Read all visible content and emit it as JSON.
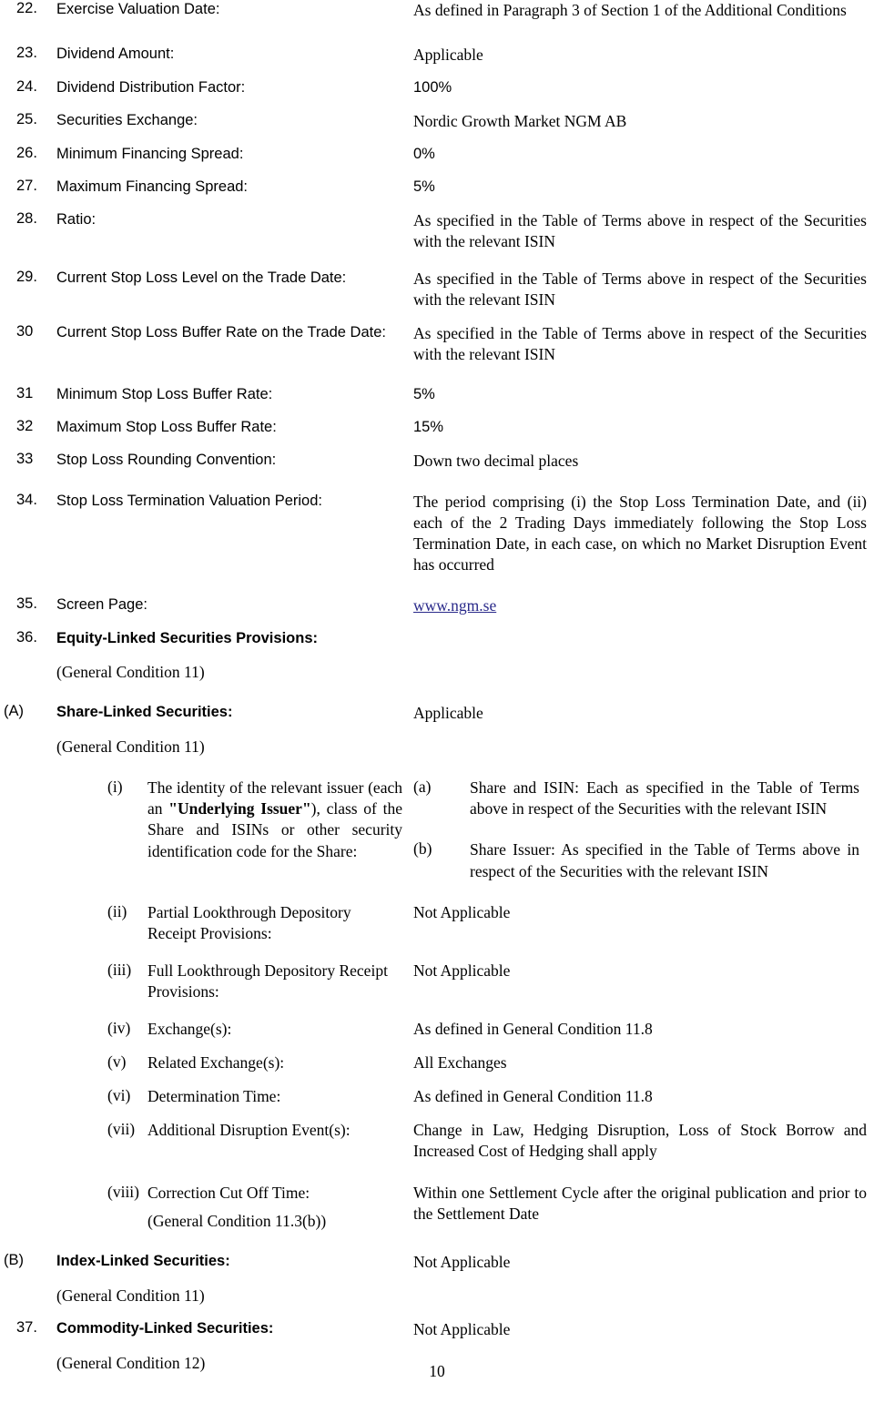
{
  "document": {
    "page_number": "10",
    "value_boilerplate": "As specified in the Table of Terms above in respect of the Securities with the relevant ISIN",
    "not_applicable": "Not Applicable",
    "applicable": "Applicable"
  },
  "items": [
    {
      "num": "22.",
      "label": "Exercise Valuation Date:",
      "value": "As defined in Paragraph 3 of Section 1 of the Additional Conditions"
    },
    {
      "num": "23.",
      "label": "Dividend Amount:",
      "value": "Applicable"
    },
    {
      "num": "24.",
      "label": "Dividend Distribution Factor:",
      "value": "100%"
    },
    {
      "num": "25.",
      "label": "Securities Exchange:",
      "value": "Nordic Growth Market NGM AB"
    },
    {
      "num": "26.",
      "label": "Minimum Financing Spread:",
      "value": "0%"
    },
    {
      "num": "27.",
      "label": "Maximum Financing Spread:",
      "value": "5%"
    },
    {
      "num": "28.",
      "label": "Ratio:",
      "value": "As specified in the Table of Terms above in respect of the Securities with the relevant ISIN"
    },
    {
      "num": "29.",
      "label": "Current Stop Loss Level on the Trade Date:",
      "value": "As specified in the Table of Terms above in respect of the Securities with the relevant ISIN"
    },
    {
      "num": "30",
      "label": "Current Stop Loss Buffer Rate on the Trade Date:",
      "value": "As specified in the Table of Terms above in respect of the Securities with the relevant ISIN"
    },
    {
      "num": "31",
      "label": "Minimum Stop Loss Buffer Rate:",
      "value": "5%"
    },
    {
      "num": "32",
      "label": "Maximum Stop Loss Buffer Rate:",
      "value": "15%"
    },
    {
      "num": "33",
      "label": "Stop Loss Rounding Convention:",
      "value": "Down two decimal places"
    },
    {
      "num": "34.",
      "label": "Stop Loss Termination Valuation Period:",
      "value": "The period comprising (i) the Stop Loss Termination Date, and (ii) each of the 2 Trading Days immediately following the Stop Loss Termination Date, in each case, on which no Market Disruption Event has occurred"
    },
    {
      "num": "35.",
      "label": "Screen Page:",
      "value": "www.ngm.se"
    }
  ],
  "equity_section": {
    "num": "36.",
    "title": "Equity-Linked Securities Provisions:",
    "condition": "(General Condition 11)",
    "share_linked": {
      "alpha": "(A)",
      "title": "Share-Linked Securities:",
      "condition": "(General Condition 11)",
      "value": "Applicable",
      "sub_items": [
        {
          "num": "(i)",
          "label_pre": "The identity of the relevant issuer (each an ",
          "label_bold": "\"Underlying Issuer\"",
          "label_post": "), class of the Share and ISINs or other security identification code for the Share:",
          "values": [
            {
              "alpha": "(a)",
              "text": "Share and ISIN: Each as specified in the Table of Terms above in respect of the Securities with the relevant ISIN"
            },
            {
              "alpha": "(b)",
              "text": "Share Issuer: As specified in the Table of Terms above in respect of the Securities with the relevant ISIN"
            }
          ]
        },
        {
          "num": "(ii)",
          "label": "Partial Lookthrough Depository Receipt Provisions:",
          "value": "Not Applicable"
        },
        {
          "num": "(iii)",
          "label": "Full Lookthrough Depository Receipt Provisions:",
          "value": "Not Applicable"
        },
        {
          "num": "(iv)",
          "label": "Exchange(s):",
          "value": "As defined in General Condition 11.8"
        },
        {
          "num": "(v)",
          "label": "Related Exchange(s):",
          "value": "All Exchanges"
        },
        {
          "num": "(vi)",
          "label": "Determination Time:",
          "value": "As defined in General Condition 11.8"
        },
        {
          "num": "(vii)",
          "label": "Additional Disruption Event(s):",
          "value": "Change in Law, Hedging Disruption, Loss of Stock Borrow and Increased Cost of Hedging shall apply"
        },
        {
          "num": "(viii)",
          "label": "Correction Cut Off Time:",
          "label_sub": "(General Condition 11.3(b))",
          "value": "Within one Settlement Cycle after the original publication and prior to the Settlement Date"
        }
      ]
    },
    "index_linked": {
      "alpha": "(B)",
      "title": "Index-Linked Securities:",
      "condition": "(General Condition 11)",
      "value": "Not Applicable"
    }
  },
  "commodity_section": {
    "num": "37.",
    "title": "Commodity-Linked Securities:",
    "condition": "(General Condition 12)",
    "value": "Not Applicable"
  }
}
